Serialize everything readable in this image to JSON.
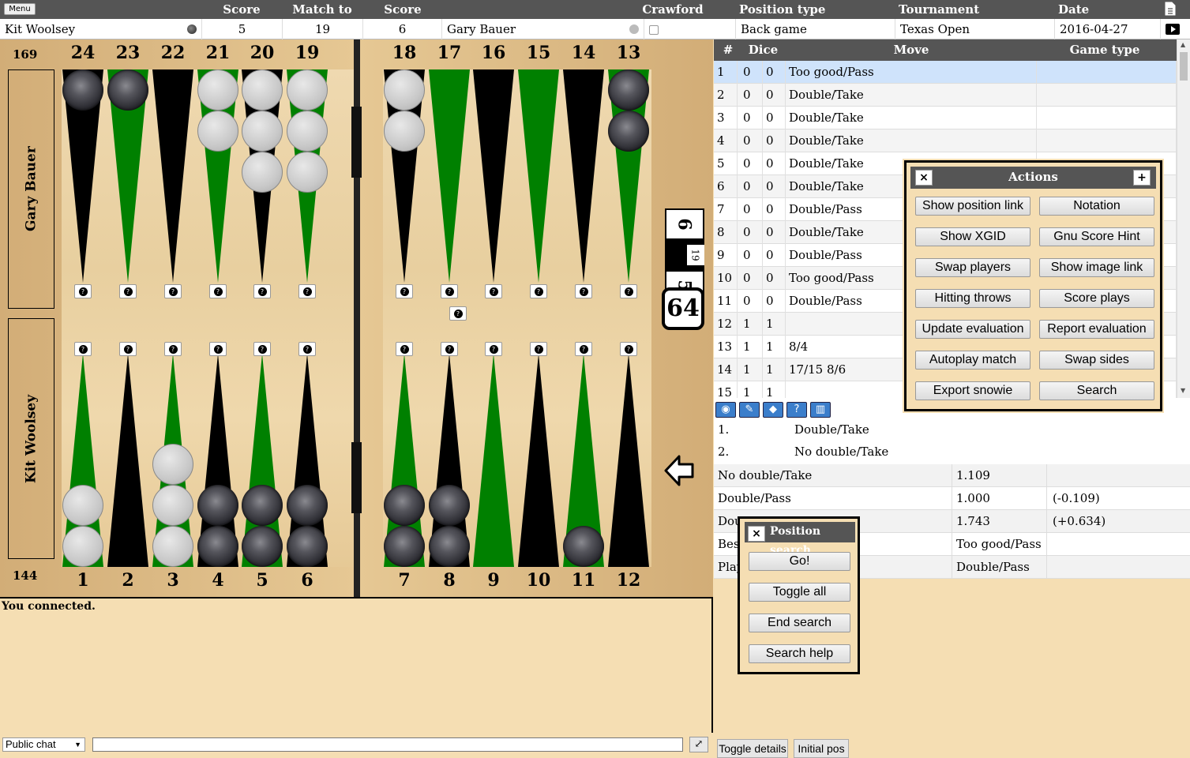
{
  "topbar": {
    "menu": "Menu",
    "score1": "Score",
    "match_to": "Match to",
    "score2": "Score",
    "crawford": "Crawford",
    "position_type": "Position type",
    "tournament": "Tournament",
    "date": "Date"
  },
  "info": {
    "player1": "Kit Woolsey",
    "score1": "5",
    "match_to": "19",
    "score2": "6",
    "player2": "Gary Bauer",
    "position_type": "Back game",
    "tournament": "Texas Open",
    "date": "2016-04-27"
  },
  "board": {
    "pip_top": "169",
    "pip_bottom": "144",
    "top_player": "Gary Bauer",
    "bottom_player": "Kit Woolsey",
    "top_points": [
      "24",
      "23",
      "22",
      "21",
      "20",
      "19",
      "18",
      "17",
      "16",
      "15",
      "14",
      "13"
    ],
    "bottom_points": [
      "1",
      "2",
      "3",
      "4",
      "5",
      "6",
      "7",
      "8",
      "9",
      "10",
      "11",
      "12"
    ],
    "cube": "64",
    "score_top": "6",
    "score_mid": "19",
    "score_bottom": "5",
    "qmark": "?"
  },
  "moves": {
    "headers": {
      "num": "#",
      "dice": "Dice",
      "move": "Move",
      "game_type": "Game type"
    },
    "rows": [
      {
        "n": "1",
        "d1": "0",
        "d2": "0",
        "move": "Too good/Pass"
      },
      {
        "n": "2",
        "d1": "0",
        "d2": "0",
        "move": "Double/Take"
      },
      {
        "n": "3",
        "d1": "0",
        "d2": "0",
        "move": "Double/Take"
      },
      {
        "n": "4",
        "d1": "0",
        "d2": "0",
        "move": "Double/Take"
      },
      {
        "n": "5",
        "d1": "0",
        "d2": "0",
        "move": "Double/Take"
      },
      {
        "n": "6",
        "d1": "0",
        "d2": "0",
        "move": "Double/Take"
      },
      {
        "n": "7",
        "d1": "0",
        "d2": "0",
        "move": "Double/Pass"
      },
      {
        "n": "8",
        "d1": "0",
        "d2": "0",
        "move": "Double/Take"
      },
      {
        "n": "9",
        "d1": "0",
        "d2": "0",
        "move": "Double/Pass"
      },
      {
        "n": "10",
        "d1": "0",
        "d2": "0",
        "move": "Too good/Pass"
      },
      {
        "n": "11",
        "d1": "0",
        "d2": "0",
        "move": "Double/Pass"
      },
      {
        "n": "12",
        "d1": "1",
        "d2": "1",
        "move": ""
      },
      {
        "n": "13",
        "d1": "1",
        "d2": "1",
        "move": "8/4"
      },
      {
        "n": "14",
        "d1": "1",
        "d2": "1",
        "move": "17/15 8/6"
      },
      {
        "n": "15",
        "d1": "1",
        "d2": "1",
        "move": ""
      }
    ]
  },
  "details": {
    "list": [
      {
        "idx": "1.",
        "text": "Double/Take"
      },
      {
        "idx": "2.",
        "text": "No double/Take"
      }
    ],
    "rows": [
      {
        "label": "No double/Take",
        "value": "1.109",
        "diff": ""
      },
      {
        "label": "Double/Pass",
        "value": "1.000",
        "diff": "(-0.109)"
      },
      {
        "label": "Dou",
        "value": "1.743",
        "diff": "(+0.634)"
      },
      {
        "label": "Bes",
        "value": "Too good/Pass",
        "diff": ""
      },
      {
        "label": "Play",
        "value": "Double/Pass",
        "diff": ""
      }
    ],
    "toggle_details": "Toggle details",
    "initial_pos": "Initial pos"
  },
  "actions": {
    "title": "Actions",
    "close": "×",
    "expand": "+",
    "buttons": [
      [
        "Show position link",
        "Notation"
      ],
      [
        "Show XGID",
        "Gnu Score Hint"
      ],
      [
        "Swap players",
        "Show image link"
      ],
      [
        "Hitting throws",
        "Score plays"
      ],
      [
        "Update evaluation",
        "Report evaluation"
      ],
      [
        "Autoplay match",
        "Swap sides"
      ],
      [
        "Export snowie",
        "Search"
      ]
    ]
  },
  "position_search": {
    "title": "Position search",
    "close": "×",
    "buttons": [
      "Go!",
      "Toggle all",
      "End search",
      "Search help"
    ]
  },
  "chat": {
    "message": "You connected.",
    "channel": "Public chat",
    "input_value": ""
  },
  "colors": {
    "green": "#008000",
    "black": "#000000",
    "header": "#555555",
    "panel": "#f5deb3"
  }
}
